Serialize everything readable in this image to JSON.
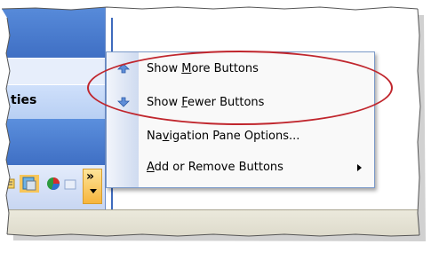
{
  "nav_pane": {
    "button_label": "ties"
  },
  "menu": {
    "items": [
      {
        "pre": "Show ",
        "key": "M",
        "post": "ore Buttons",
        "icon": "arrow-up-icon"
      },
      {
        "pre": "Show ",
        "key": "F",
        "post": "ewer Buttons",
        "icon": "arrow-down-icon"
      },
      {
        "pre": "Na",
        "key": "v",
        "post": "igation Pane Options...",
        "icon": ""
      },
      {
        "pre": "",
        "key": "A",
        "post": "dd or Remove Buttons",
        "icon": "",
        "submenu": true
      }
    ]
  },
  "chevron": {
    "label": "»"
  },
  "colors": {
    "accent": "#3f6fc4",
    "highlight": "#c0262d",
    "toolbar_hot": "#f7b53c"
  }
}
